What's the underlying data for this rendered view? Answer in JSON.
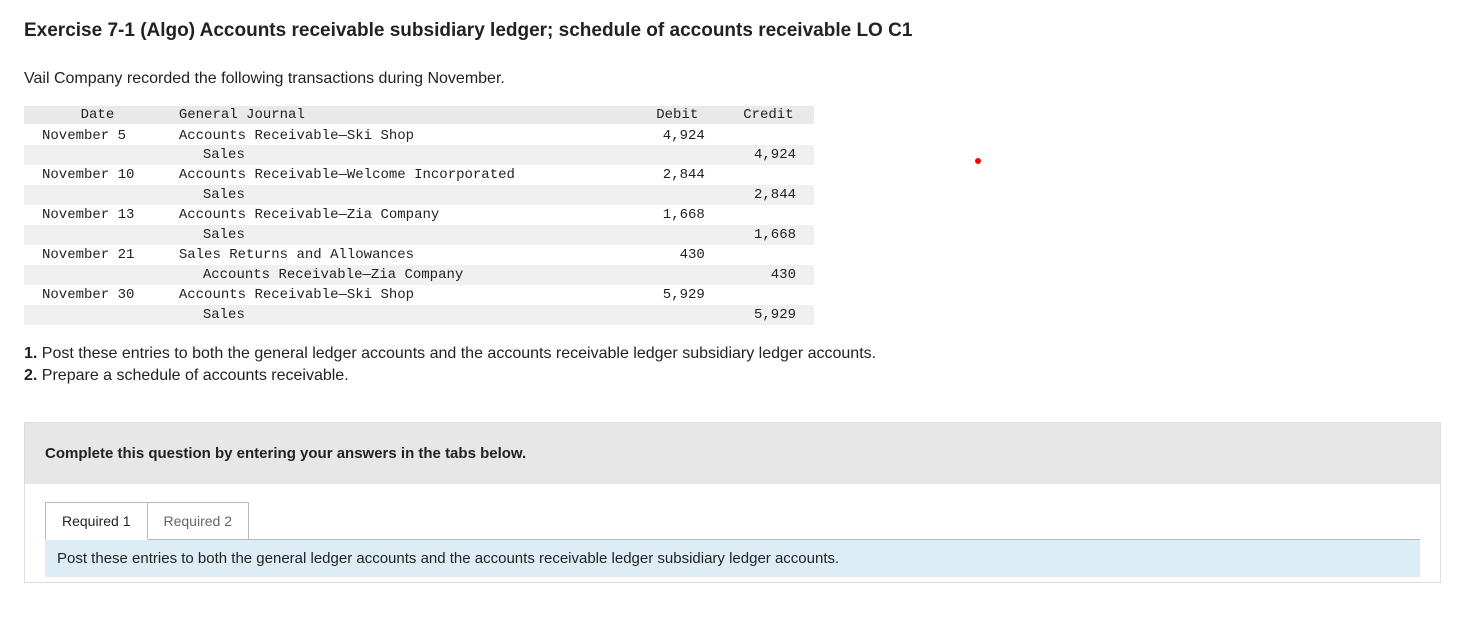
{
  "title": "Exercise 7-1 (Algo) Accounts receivable subsidiary ledger; schedule of accounts receivable LO C1",
  "intro": "Vail Company recorded the following transactions during November.",
  "journal": {
    "headers": {
      "date": "Date",
      "desc": "General Journal",
      "debit": "Debit",
      "credit": "Credit"
    },
    "rows": [
      {
        "date": "November 5",
        "desc": "Accounts Receivable—Ski Shop",
        "indent": 1,
        "debit": "4,924",
        "credit": ""
      },
      {
        "date": "",
        "desc": "Sales",
        "indent": 2,
        "debit": "",
        "credit": "4,924"
      },
      {
        "date": "November 10",
        "desc": "Accounts Receivable—Welcome Incorporated",
        "indent": 1,
        "debit": "2,844",
        "credit": ""
      },
      {
        "date": "",
        "desc": "Sales",
        "indent": 2,
        "debit": "",
        "credit": "2,844"
      },
      {
        "date": "November 13",
        "desc": "Accounts Receivable—Zia Company",
        "indent": 1,
        "debit": "1,668",
        "credit": ""
      },
      {
        "date": "",
        "desc": "Sales",
        "indent": 2,
        "debit": "",
        "credit": "1,668"
      },
      {
        "date": "November 21",
        "desc": "Sales Returns and Allowances",
        "indent": 1,
        "debit": "430",
        "credit": ""
      },
      {
        "date": "",
        "desc": "Accounts Receivable—Zia Company",
        "indent": 2,
        "debit": "",
        "credit": "430"
      },
      {
        "date": "November 30",
        "desc": "Accounts Receivable—Ski Shop",
        "indent": 1,
        "debit": "5,929",
        "credit": ""
      },
      {
        "date": "",
        "desc": "Sales",
        "indent": 2,
        "debit": "",
        "credit": "5,929"
      }
    ]
  },
  "instructions": {
    "i1num": "1.",
    "i1": " Post these entries to both the general ledger accounts and the accounts receivable ledger subsidiary ledger accounts.",
    "i2num": "2.",
    "i2": " Prepare a schedule of accounts receivable."
  },
  "answer_banner": "Complete this question by entering your answers in the tabs below.",
  "tabs": {
    "t1": "Required 1",
    "t2": "Required 2"
  },
  "tab_instruction": "Post these entries to both the general ledger accounts and the accounts receivable ledger subsidiary ledger accounts."
}
